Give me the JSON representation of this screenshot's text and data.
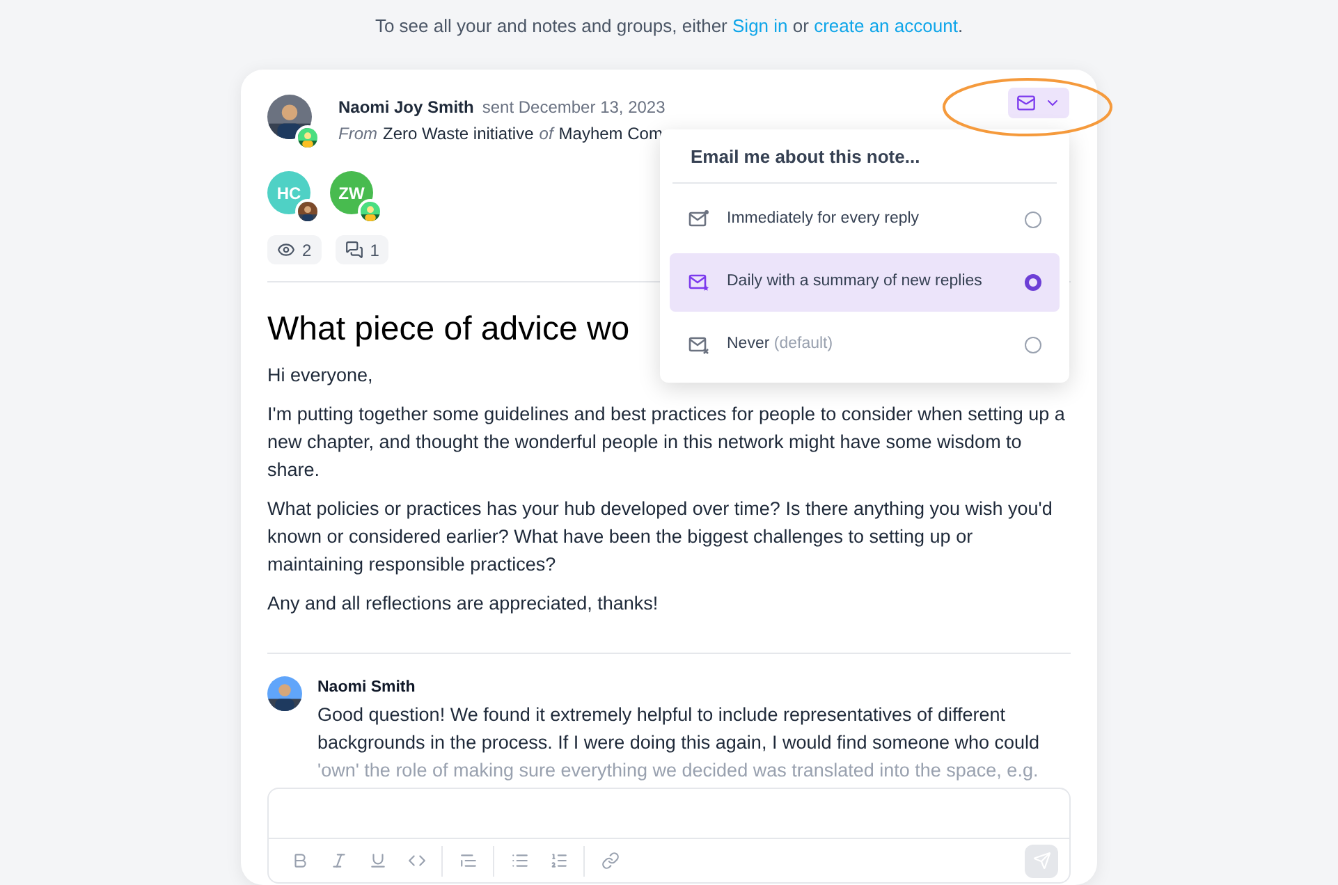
{
  "banner": {
    "before": "To see all your and notes and groups, either",
    "link1": "Sign in",
    "middle": "or",
    "link2": "create an account",
    "after": "."
  },
  "note": {
    "author": "Naomi Joy Smith",
    "sent": "sent December 13, 2023",
    "from_label": "From",
    "group": "Zero Waste initiative",
    "of_label": "of",
    "network": "Mayhem Com",
    "participants": [
      {
        "initials": "HC",
        "color": "#4fd1c5"
      },
      {
        "initials": "ZW",
        "color": "#48bb4f"
      }
    ],
    "views": "2",
    "replies": "1",
    "title": "What piece of advice wo",
    "paragraphs": [
      "Hi everyone,",
      "I'm putting together some guidelines and best practices for people to consider when setting up a new chapter, and thought the wonderful people in this network might have some wisdom to share.",
      "What policies or practices has your hub developed over time? Is there anything you wish you'd known or considered earlier? What have been the biggest challenges to setting up or maintaining responsible practices?",
      "Any and all reflections are appreciated, thanks!"
    ]
  },
  "email_menu": {
    "expanded": true,
    "heading": "Email me about this note...",
    "options": [
      {
        "kind": "immediate",
        "label": "Immediately for every reply",
        "selected": false
      },
      {
        "kind": "daily",
        "label": "Daily with a summary of new replies",
        "selected": true
      },
      {
        "kind": "never",
        "label": "Never",
        "note": "(default)",
        "selected": false
      }
    ]
  },
  "reply": {
    "author": "Naomi Smith",
    "lines": [
      "Good question! We found it extremely helpful to include representatives of different backgrounds in the process. If I were doing this again, I would find someone who could",
      "'own' the role of making sure everything we decided was translated into the space, e.g."
    ]
  }
}
